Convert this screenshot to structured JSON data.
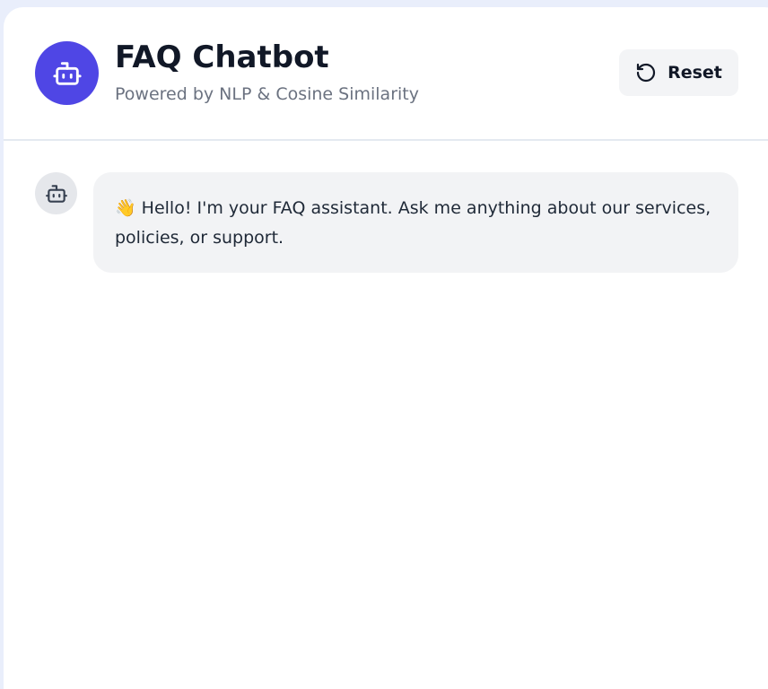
{
  "header": {
    "title": "FAQ Chatbot",
    "subtitle": "Powered by NLP & Cosine Similarity",
    "logo_icon": "robot-icon",
    "reset_label": "Reset",
    "reset_icon": "rotate-ccw-icon"
  },
  "messages": [
    {
      "sender": "bot",
      "avatar_icon": "robot-icon",
      "emoji": "👋",
      "text": "Hello! I'm your FAQ assistant. Ask me anything about our services, policies, or support."
    }
  ],
  "colors": {
    "accent": "#4f46e5",
    "page_background": "#e9eefb",
    "bubble_background": "#f2f3f5",
    "button_background": "#f3f4f6"
  }
}
